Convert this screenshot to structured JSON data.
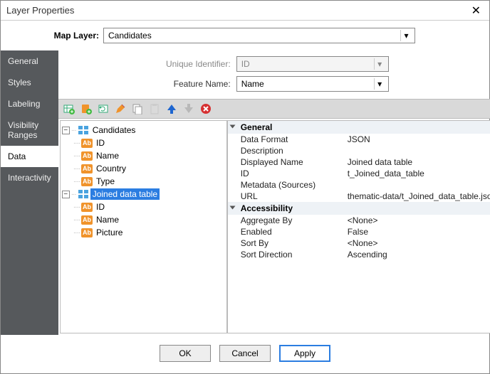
{
  "window": {
    "title": "Layer Properties"
  },
  "map_layer": {
    "label": "Map Layer:",
    "value": "Candidates"
  },
  "form": {
    "unique_id_label": "Unique Identifier:",
    "unique_id_value": "ID",
    "feature_label": "Feature Name:",
    "feature_value": "Name"
  },
  "sidebar": {
    "items": [
      {
        "label": "General"
      },
      {
        "label": "Styles"
      },
      {
        "label": "Labeling"
      },
      {
        "label": "Visibility Ranges"
      },
      {
        "label": "Data"
      },
      {
        "label": "Interactivity"
      }
    ],
    "active_index": 4
  },
  "tree": {
    "root": {
      "label": "Candidates",
      "children": [
        "ID",
        "Name",
        "Country",
        "Type"
      ]
    },
    "joined": {
      "label": "Joined data table",
      "children": [
        "ID",
        "Name",
        "Picture"
      ]
    }
  },
  "props": {
    "groups": [
      {
        "title": "General",
        "rows": [
          {
            "k": "Data Format",
            "v": "JSON"
          },
          {
            "k": "Description",
            "v": ""
          },
          {
            "k": "Displayed Name",
            "v": "Joined data table"
          },
          {
            "k": "ID",
            "v": "t_Joined_data_table"
          },
          {
            "k": "Metadata (Sources)",
            "v": ""
          },
          {
            "k": "URL",
            "v": "thematic-data/t_Joined_data_table.json"
          }
        ]
      },
      {
        "title": "Accessibility",
        "rows": [
          {
            "k": "Aggregate By",
            "v": "<None>"
          },
          {
            "k": "Enabled",
            "v": "False"
          },
          {
            "k": "Sort By",
            "v": "<None>"
          },
          {
            "k": "Sort Direction",
            "v": "Ascending"
          }
        ]
      }
    ]
  },
  "buttons": {
    "ok": "OK",
    "cancel": "Cancel",
    "apply": "Apply"
  }
}
